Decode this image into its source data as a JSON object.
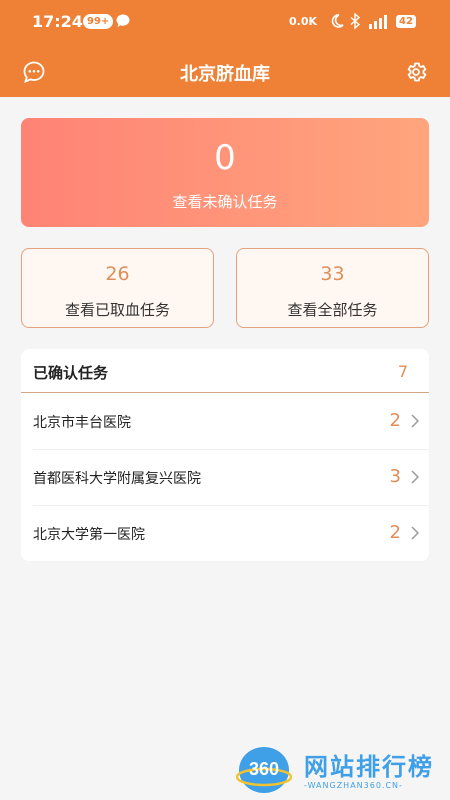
{
  "status_bar": {
    "time": "17:24",
    "badge": "99+",
    "net_speed": "0.0K",
    "battery": "42"
  },
  "nav": {
    "title": "北京脐血库",
    "left_icon": "message-icon",
    "right_icon": "settings-icon"
  },
  "summary": {
    "unconfirmed": {
      "count": "0",
      "label": "查看未确认任务"
    },
    "collected": {
      "count": "26",
      "label": "查看已取血任务"
    },
    "all": {
      "count": "33",
      "label": "查看全部任务"
    }
  },
  "confirmed": {
    "title": "已确认任务",
    "count": "7",
    "items": [
      {
        "name": "北京市丰台医院",
        "count": "2"
      },
      {
        "name": "首都医科大学附属复兴医院",
        "count": "3"
      },
      {
        "name": "北京大学第一医院",
        "count": "2"
      }
    ]
  },
  "watermark": {
    "logo": "360",
    "text": "网站排行榜",
    "sub": "-WANGZHAN360.CN-"
  },
  "colors": {
    "header": "#ee8135",
    "accent": "#de8f59",
    "gradient_start": "#ff8375",
    "gradient_end": "#ffa57d"
  }
}
